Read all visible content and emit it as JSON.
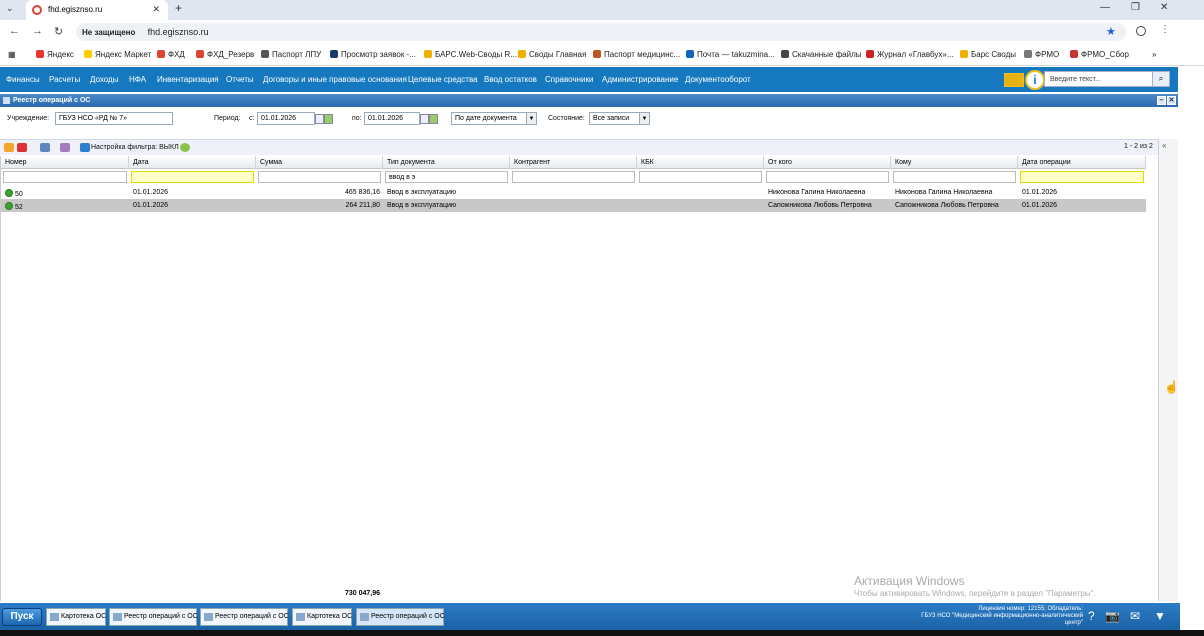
{
  "browser": {
    "tab_title": "fhd.egisznso.ru",
    "insecure_label": "Не защищено",
    "url": "fhd.egisznso.ru",
    "bookmarks": [
      {
        "label": "Яндекс",
        "color": "#e33"
      },
      {
        "label": "Яндекс Маркет",
        "color": "#fc0"
      },
      {
        "label": "ФХД",
        "color": "#d43"
      },
      {
        "label": "ФХД_Резерв",
        "color": "#d43"
      },
      {
        "label": "Паспорт ЛПУ",
        "color": "#555"
      },
      {
        "label": "Просмотр заявок -...",
        "color": "#1a3a6a"
      },
      {
        "label": "БАРС.Web-Своды R...",
        "color": "#f0b000"
      },
      {
        "label": "Своды Главная",
        "color": "#f0b000"
      },
      {
        "label": "Паспорт медицинс...",
        "color": "#b52"
      },
      {
        "label": "Почта — takuzmina...",
        "color": "#1565c0"
      },
      {
        "label": "Скачанные файлы",
        "color": "#444"
      },
      {
        "label": "Журнал «Главбух»...",
        "color": "#c22"
      },
      {
        "label": "Барс Своды",
        "color": "#f0b000"
      },
      {
        "label": "ФРМО",
        "color": "#777"
      },
      {
        "label": "ФРМО_Сбор",
        "color": "#c33"
      }
    ],
    "more_bookmarks": "»"
  },
  "menu": {
    "items": [
      "Финансы",
      "Расчеты",
      "Доходы",
      "НФА",
      "Инвентаризация",
      "Отчеты",
      "Договоры и иные правовые основания",
      "Целевые средства",
      "Ввод остатков",
      "Справочники",
      "Администрирование",
      "Документооборот"
    ],
    "search_placeholder": "Введите текст...",
    "info_glyph": "i"
  },
  "window": {
    "title": "Реестр операций с ОС"
  },
  "filters": {
    "institution_label": "Учреждение:",
    "institution_value": "ГБУЗ НСО «РД № 7»",
    "period_label": "Период:",
    "from_label": "с:",
    "from_value": "01.01.2026",
    "to_label": "по:",
    "to_value": "01.01.2026",
    "date_mode": "По дате документа",
    "state_label": "Состояние:",
    "state_value": "Все записи"
  },
  "toolbar": {
    "filter_setting": "Настройка фильтра: ВЫКЛ",
    "pager": "1 - 2 из 2"
  },
  "grid": {
    "columns": [
      "Номер",
      "Дата",
      "Сумма",
      "Тип документа",
      "Контрагент",
      "КБК",
      "От кого",
      "Кому",
      "Дата операции"
    ],
    "filter_values": [
      "",
      "",
      "",
      "ввод в э",
      "",
      "",
      "",
      "",
      ""
    ],
    "rows": [
      {
        "number": "50",
        "date": "01.01.2026",
        "sum": "465 836,16",
        "doc_type": "Ввод в эксплуатацию",
        "counterparty": "",
        "kbk": "",
        "from": "Никонова Галина Николаевна",
        "to": "Никонова Галина Николаевна",
        "op_date": "01.01.2026"
      },
      {
        "number": "52",
        "date": "01.01.2026",
        "sum": "264 211,80",
        "doc_type": "Ввод в эксплуатацию",
        "counterparty": "",
        "kbk": "",
        "from": "Сапожникова Любовь Петровна",
        "to": "Сапожникова Любовь Петровна",
        "op_date": "01.01.2026"
      }
    ],
    "total": "730 047,96"
  },
  "watermark": {
    "line1": "Активация Windows",
    "line2": "Чтобы активировать Windows, перейдите в раздел \"Параметры\"."
  },
  "taskbar": {
    "start": "Пуск",
    "tasks": [
      "Картотека ОС",
      "Реестр операций с ОС",
      "Реестр операций с ОС",
      "Картотека ОС",
      "Реестр операций с ОС"
    ],
    "license_line1": "Лицензия номер: 12155; Обладатель:",
    "license_line2": "ГБУЗ НСО \"Медицинский информационно-аналитический",
    "license_line3": "центр\""
  }
}
